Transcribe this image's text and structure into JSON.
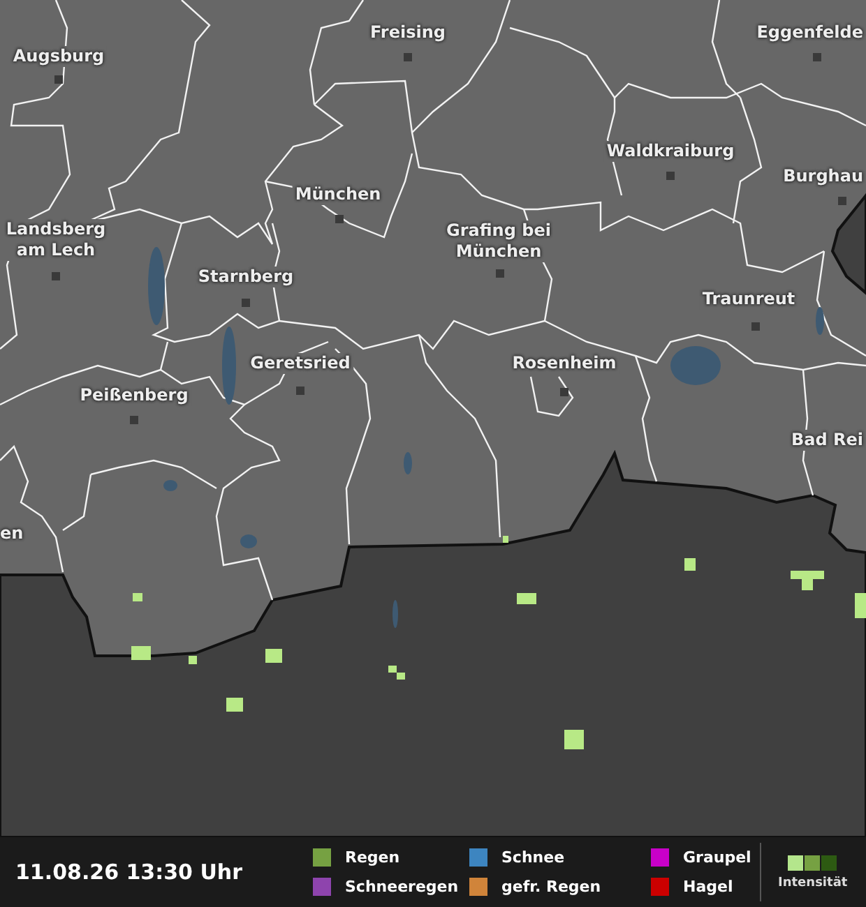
{
  "map": {
    "cities": [
      {
        "name": "Augsburg",
        "marker": true
      },
      {
        "name": "Freising",
        "marker": true
      },
      {
        "name": "Eggenfelde",
        "marker": true
      },
      {
        "name": "Waldkraiburg",
        "marker": true
      },
      {
        "name": "Burghau",
        "marker": true
      },
      {
        "name": "München",
        "marker": true
      },
      {
        "name": "Landsberg am Lech",
        "marker": true
      },
      {
        "name": "Grafing bei München",
        "marker": true
      },
      {
        "name": "Starnberg",
        "marker": true
      },
      {
        "name": "Traunreut",
        "marker": true
      },
      {
        "name": "Geretsried",
        "marker": true
      },
      {
        "name": "Rosenheim",
        "marker": true
      },
      {
        "name": "Peißenberg",
        "marker": true
      },
      {
        "name": "Bad Rei",
        "marker": false
      },
      {
        "name": "en",
        "marker": false
      }
    ]
  },
  "footer": {
    "timestamp": "11.08.26 13:30 Uhr",
    "legend": [
      {
        "label": "Regen",
        "color": "#76a142"
      },
      {
        "label": "Schneeregen",
        "color": "#8e44ad"
      },
      {
        "label": "Schnee",
        "color": "#3d85c0"
      },
      {
        "label": "gefr. Regen",
        "color": "#d0843a"
      },
      {
        "label": "Graupel",
        "color": "#c800c8"
      },
      {
        "label": "Hagel",
        "color": "#cc0000"
      }
    ],
    "intensity": {
      "label": "Intensität",
      "swatches": [
        {
          "color": "#b4e68c"
        },
        {
          "color": "#76a142"
        },
        {
          "color": "#2d5a12"
        }
      ]
    }
  }
}
